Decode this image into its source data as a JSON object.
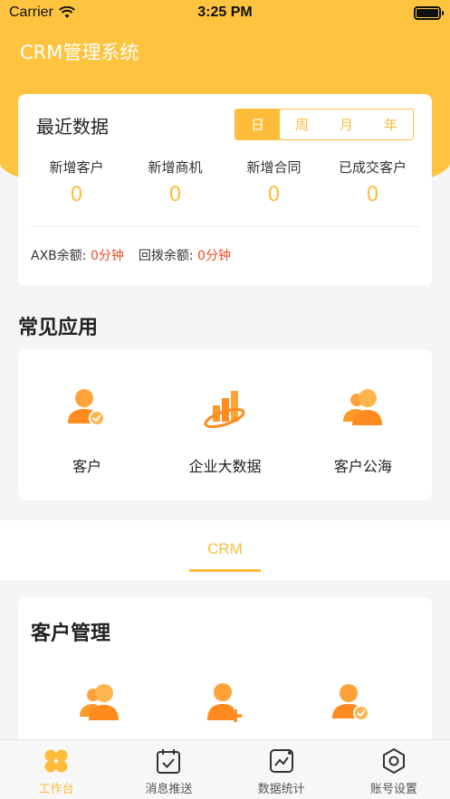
{
  "status_bar": {
    "carrier": "Carrier",
    "time": "3:25 PM"
  },
  "app_title": "CRM管理系统",
  "recent": {
    "title": "最近数据",
    "periods": [
      "日",
      "周",
      "月",
      "年"
    ],
    "active_period": "日",
    "stats": [
      {
        "label": "新增客户",
        "value": "0"
      },
      {
        "label": "新增商机",
        "value": "0"
      },
      {
        "label": "新增合同",
        "value": "0"
      },
      {
        "label": "已成交客户",
        "value": "0"
      }
    ],
    "axb_label": "AXB余额:",
    "axb_value": "0分钟",
    "callback_label": "回拨余额:",
    "callback_value": "0分钟"
  },
  "common_apps": {
    "title": "常见应用",
    "items": [
      {
        "label": "客户",
        "icon": "customer-check-icon"
      },
      {
        "label": "企业大数据",
        "icon": "enterprise-data-icon"
      },
      {
        "label": "客户公海",
        "icon": "customer-pool-icon"
      }
    ]
  },
  "tab_strip": {
    "label": "CRM"
  },
  "customer_mgmt": {
    "title": "客户管理",
    "icons": [
      "customers-group-icon",
      "add-customer-icon",
      "verified-customer-icon"
    ]
  },
  "tabbar": [
    {
      "label": "工作台",
      "icon": "workbench-icon",
      "active": true
    },
    {
      "label": "消息推送",
      "icon": "calendar-check-icon",
      "active": false
    },
    {
      "label": "数据统计",
      "icon": "chart-icon",
      "active": false
    },
    {
      "label": "账号设置",
      "icon": "settings-hex-icon",
      "active": false
    }
  ],
  "colors": {
    "accent": "#fdbd3b",
    "header": "#fec43f",
    "alert": "#f04a24",
    "icon_orange": "#ff8a1d"
  }
}
